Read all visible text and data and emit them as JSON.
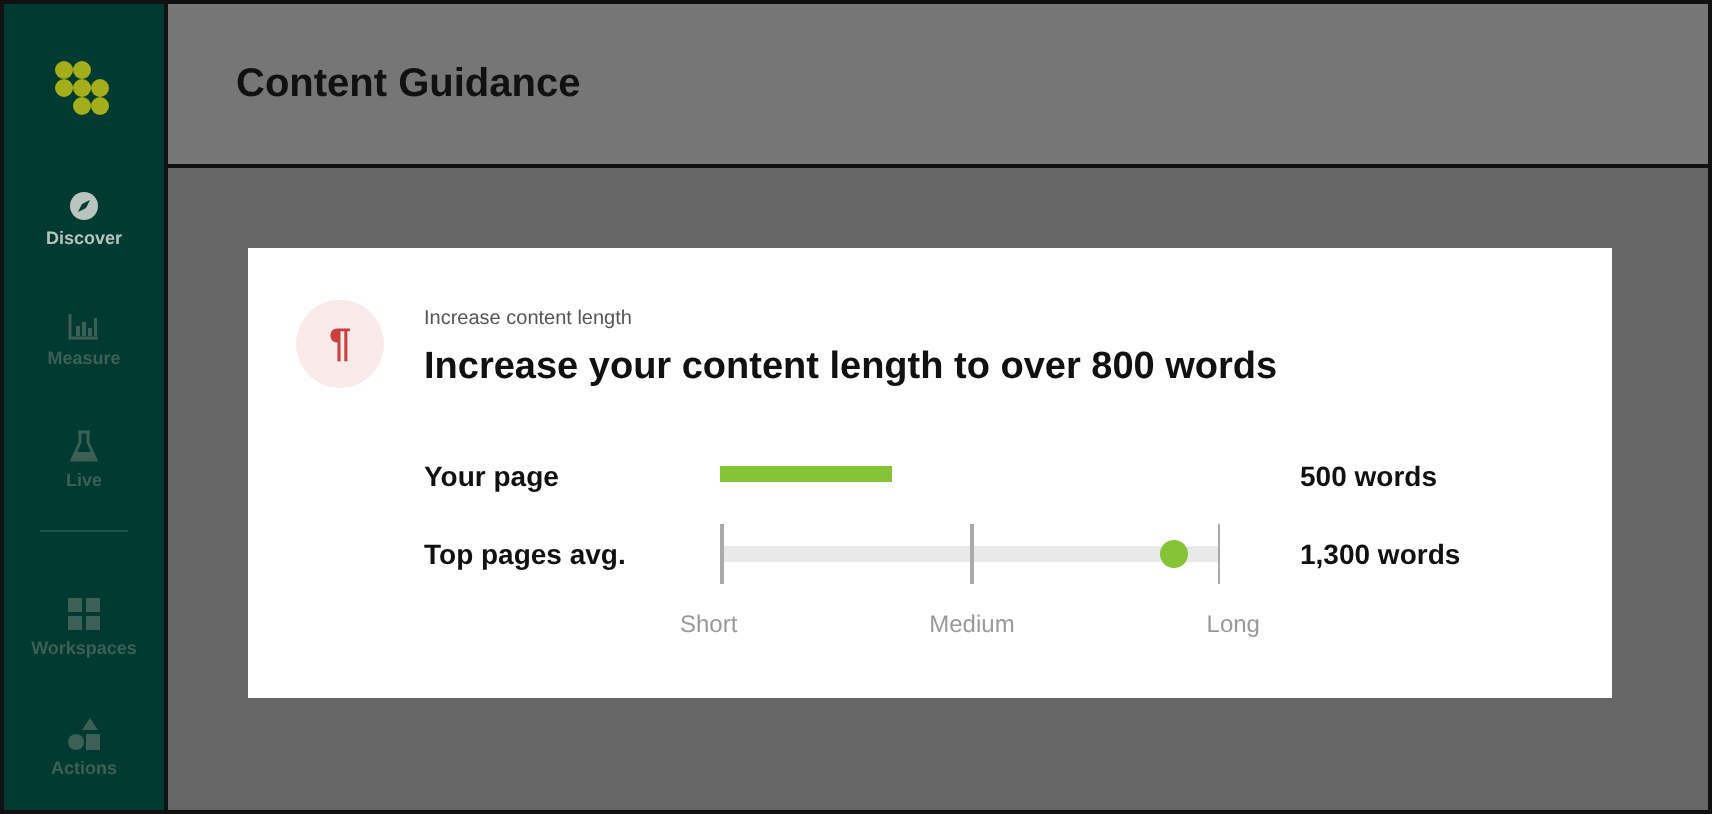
{
  "sidebar": {
    "items": [
      {
        "label": "Discover",
        "kind": "compass",
        "selected": true
      },
      {
        "label": "Measure",
        "kind": "chart",
        "selected": false
      },
      {
        "label": "Live",
        "kind": "flask",
        "selected": false
      },
      {
        "label": "Workspaces",
        "kind": "grid",
        "selected": false,
        "divider_before": true
      },
      {
        "label": "Actions",
        "kind": "shapes",
        "selected": false
      }
    ]
  },
  "header": {
    "title": "Content Guidance"
  },
  "card": {
    "icon_glyph": "¶",
    "eyebrow": "Increase content length",
    "headline": "Increase your content length to over 800 words",
    "rows": [
      {
        "kind": "bar",
        "label": "Your page",
        "level": 0.344,
        "reading": "500 words"
      },
      {
        "kind": "dot",
        "label": "Top pages avg.",
        "level": 0.908,
        "reading": "1,300 words"
      }
    ],
    "scale": [
      "Short",
      "Medium",
      "Long"
    ]
  }
}
